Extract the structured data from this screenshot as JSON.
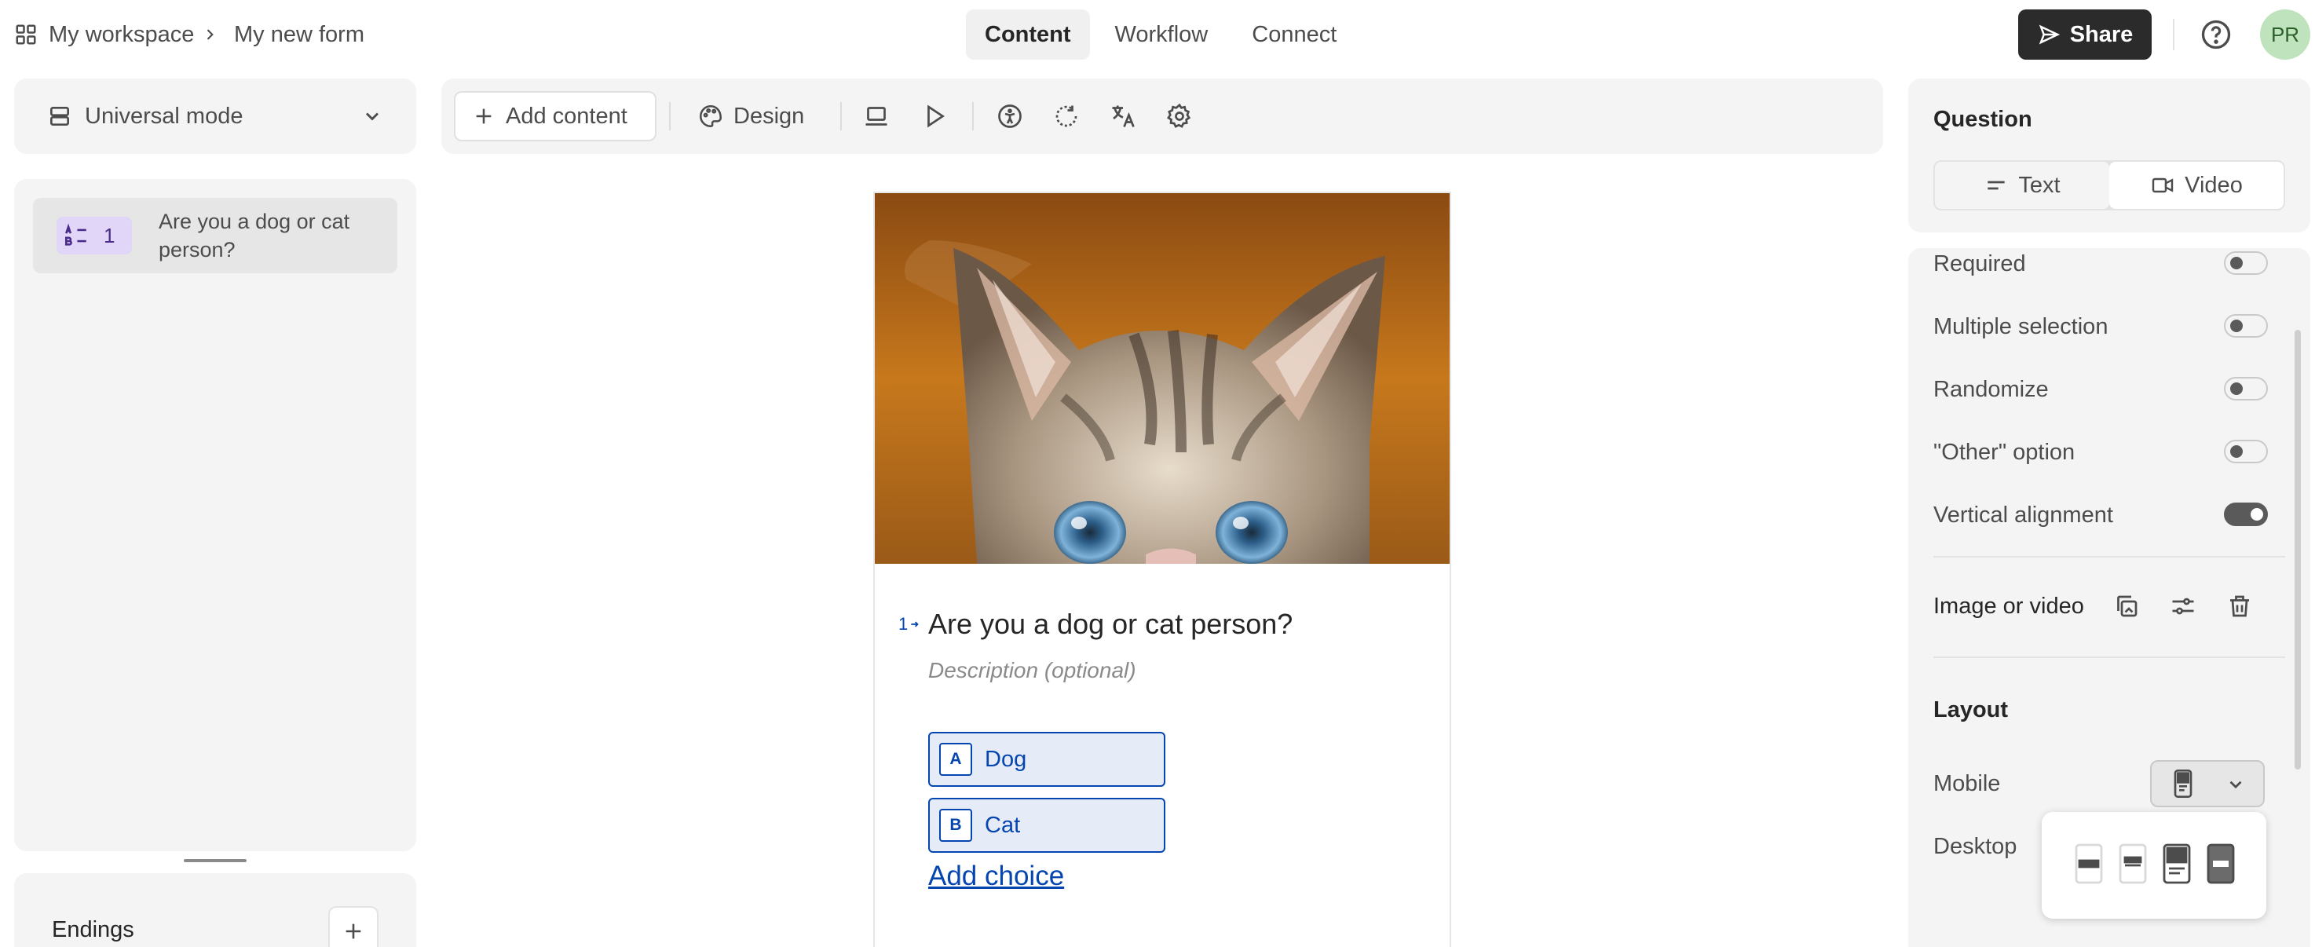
{
  "breadcrumb": {
    "workspace": "My workspace",
    "form": "My new form"
  },
  "tabs": [
    {
      "label": "Content",
      "active": true
    },
    {
      "label": "Workflow",
      "active": false
    },
    {
      "label": "Connect",
      "active": false
    }
  ],
  "header": {
    "share_label": "Share",
    "avatar_initials": "PR",
    "help_icon": "question-circle-icon"
  },
  "sidebar": {
    "mode_label": "Universal mode",
    "questions": [
      {
        "number": "1",
        "title": "Are you a dog or cat person?",
        "type_icon": "multiple-choice-icon"
      }
    ],
    "endings_label": "Endings"
  },
  "toolbar": {
    "add_content_label": "Add content",
    "design_label": "Design",
    "icons": [
      "laptop-preview-icon",
      "play-icon",
      "accessibility-icon",
      "rotate-icon",
      "translate-icon",
      "settings-icon"
    ]
  },
  "form_preview": {
    "question_number": "1",
    "question_title": "Are you a dog or cat person?",
    "description_placeholder": "Description (optional)",
    "choices": [
      {
        "key": "A",
        "label": "Dog"
      },
      {
        "key": "B",
        "label": "Cat"
      }
    ],
    "add_choice_label": "Add choice",
    "image_alt": "kitten-face-image"
  },
  "settings_panel": {
    "title": "Question",
    "segment": [
      {
        "label": "Text",
        "selected": true
      },
      {
        "label": "Video",
        "selected": false
      }
    ],
    "toggles": [
      {
        "label": "Required",
        "on": false
      },
      {
        "label": "Multiple selection",
        "on": false
      },
      {
        "label": "Randomize",
        "on": false
      },
      {
        "label": "\"Other\" option",
        "on": false
      },
      {
        "label": "Vertical alignment",
        "on": true
      }
    ],
    "image_or_video_label": "Image or video",
    "layout_title": "Layout",
    "mobile_label": "Mobile",
    "desktop_label": "Desktop"
  },
  "colors": {
    "accent_blue": "#0445af",
    "choice_bg": "#e6ecf7",
    "share_bg": "#2b2b2b",
    "avatar_bg": "#bfe3bd",
    "badge_bg": "#e1d6f8"
  }
}
